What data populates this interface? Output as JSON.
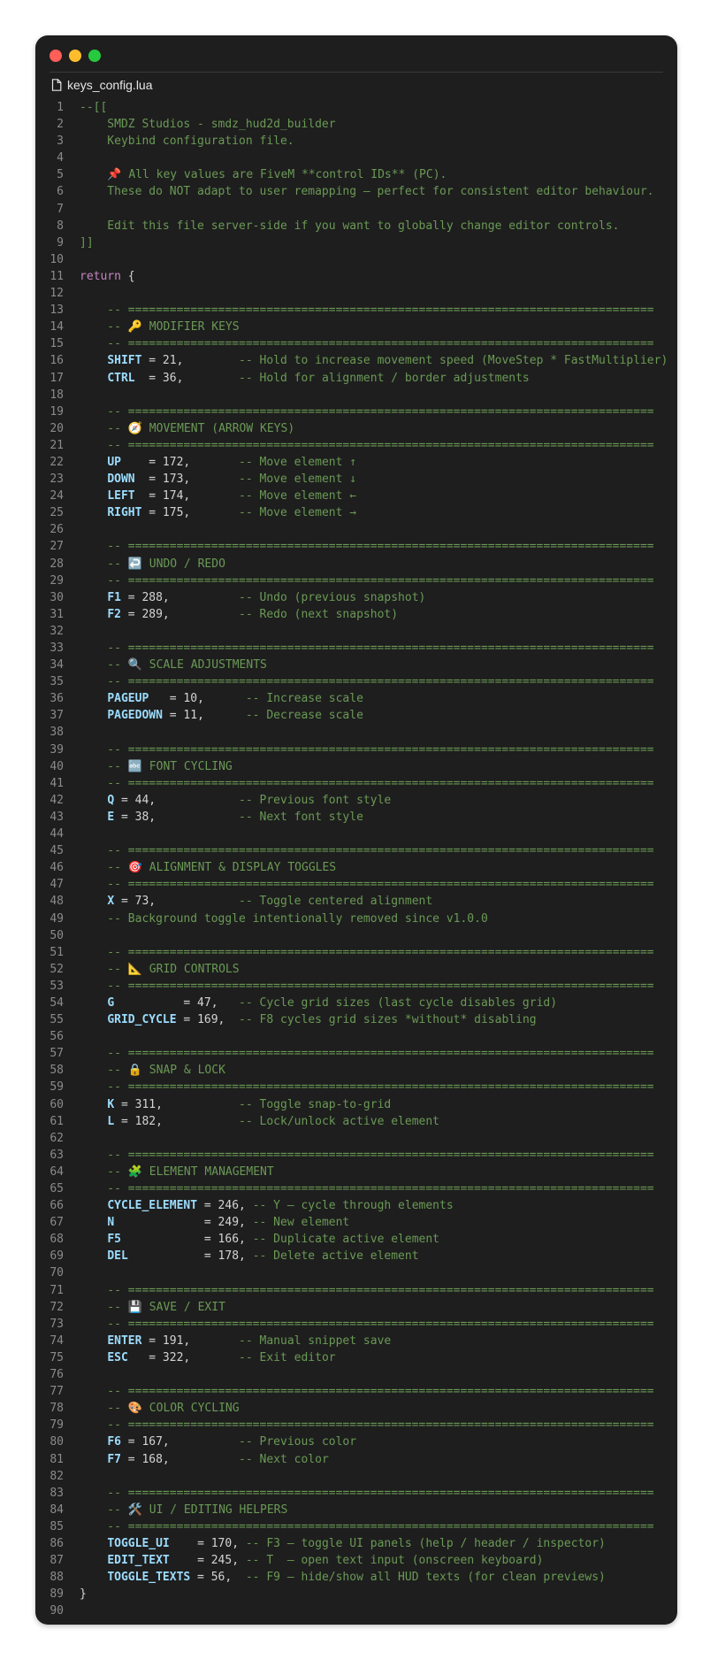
{
  "window": {
    "filename": "keys_config.lua",
    "icons": {
      "file": "file-icon"
    },
    "colors": {
      "background": "#1e1e1e",
      "comment": "#6a9955",
      "keyword": "#c586c0",
      "identifier": "#9cdcfe",
      "line_number": "#8b8b8b"
    }
  },
  "lines": [
    [
      [
        "c",
        "--[["
      ]
    ],
    [
      [
        "c",
        "    SMDZ Studios - smdz_hud2d_builder"
      ]
    ],
    [
      [
        "c",
        "    Keybind configuration file."
      ]
    ],
    [],
    [
      [
        "c",
        "    📌 All key values are FiveM **control IDs** (PC)."
      ]
    ],
    [
      [
        "c",
        "    These do NOT adapt to user remapping — perfect for consistent editor behaviour."
      ]
    ],
    [],
    [
      [
        "c",
        "    Edit this file server-side if you want to globally change editor controls."
      ]
    ],
    [
      [
        "c",
        "]]"
      ]
    ],
    [],
    [
      [
        "k",
        "return"
      ],
      [
        "p",
        " {"
      ]
    ],
    [],
    [
      [
        "c",
        "    -- ============================================================================"
      ]
    ],
    [
      [
        "c",
        "    -- 🔑 MODIFIER KEYS"
      ]
    ],
    [
      [
        "c",
        "    -- ============================================================================"
      ]
    ],
    [
      [
        "p",
        "    "
      ],
      [
        "id",
        "SHIFT"
      ],
      [
        "p",
        " = 21,        "
      ],
      [
        "c",
        "-- Hold to increase movement speed (MoveStep * FastMultiplier)"
      ]
    ],
    [
      [
        "p",
        "    "
      ],
      [
        "id",
        "CTRL"
      ],
      [
        "p",
        "  = 36,        "
      ],
      [
        "c",
        "-- Hold for alignment / border adjustments"
      ]
    ],
    [],
    [
      [
        "c",
        "    -- ============================================================================"
      ]
    ],
    [
      [
        "c",
        "    -- 🧭 MOVEMENT (ARROW KEYS)"
      ]
    ],
    [
      [
        "c",
        "    -- ============================================================================"
      ]
    ],
    [
      [
        "p",
        "    "
      ],
      [
        "id",
        "UP"
      ],
      [
        "p",
        "    = 172,       "
      ],
      [
        "c",
        "-- Move element ↑"
      ]
    ],
    [
      [
        "p",
        "    "
      ],
      [
        "id",
        "DOWN"
      ],
      [
        "p",
        "  = 173,       "
      ],
      [
        "c",
        "-- Move element ↓"
      ]
    ],
    [
      [
        "p",
        "    "
      ],
      [
        "id",
        "LEFT"
      ],
      [
        "p",
        "  = 174,       "
      ],
      [
        "c",
        "-- Move element ←"
      ]
    ],
    [
      [
        "p",
        "    "
      ],
      [
        "id",
        "RIGHT"
      ],
      [
        "p",
        " = 175,       "
      ],
      [
        "c",
        "-- Move element →"
      ]
    ],
    [],
    [
      [
        "c",
        "    -- ============================================================================"
      ]
    ],
    [
      [
        "c",
        "    -- ↩️ UNDO / REDO"
      ]
    ],
    [
      [
        "c",
        "    -- ============================================================================"
      ]
    ],
    [
      [
        "p",
        "    "
      ],
      [
        "id",
        "F1"
      ],
      [
        "p",
        " = 288,          "
      ],
      [
        "c",
        "-- Undo (previous snapshot)"
      ]
    ],
    [
      [
        "p",
        "    "
      ],
      [
        "id",
        "F2"
      ],
      [
        "p",
        " = 289,          "
      ],
      [
        "c",
        "-- Redo (next snapshot)"
      ]
    ],
    [],
    [
      [
        "c",
        "    -- ============================================================================"
      ]
    ],
    [
      [
        "c",
        "    -- 🔍 SCALE ADJUSTMENTS"
      ]
    ],
    [
      [
        "c",
        "    -- ============================================================================"
      ]
    ],
    [
      [
        "p",
        "    "
      ],
      [
        "id",
        "PAGEUP"
      ],
      [
        "p",
        "   = 10,      "
      ],
      [
        "c",
        "-- Increase scale"
      ]
    ],
    [
      [
        "p",
        "    "
      ],
      [
        "id",
        "PAGEDOWN"
      ],
      [
        "p",
        " = 11,      "
      ],
      [
        "c",
        "-- Decrease scale"
      ]
    ],
    [],
    [
      [
        "c",
        "    -- ============================================================================"
      ]
    ],
    [
      [
        "c",
        "    -- 🔤 FONT CYCLING"
      ]
    ],
    [
      [
        "c",
        "    -- ============================================================================"
      ]
    ],
    [
      [
        "p",
        "    "
      ],
      [
        "id",
        "Q"
      ],
      [
        "p",
        " = 44,            "
      ],
      [
        "c",
        "-- Previous font style"
      ]
    ],
    [
      [
        "p",
        "    "
      ],
      [
        "id",
        "E"
      ],
      [
        "p",
        " = 38,            "
      ],
      [
        "c",
        "-- Next font style"
      ]
    ],
    [],
    [
      [
        "c",
        "    -- ============================================================================"
      ]
    ],
    [
      [
        "c",
        "    -- 🎯 ALIGNMENT & DISPLAY TOGGLES"
      ]
    ],
    [
      [
        "c",
        "    -- ============================================================================"
      ]
    ],
    [
      [
        "p",
        "    "
      ],
      [
        "id",
        "X"
      ],
      [
        "p",
        " = 73,            "
      ],
      [
        "c",
        "-- Toggle centered alignment"
      ]
    ],
    [
      [
        "c",
        "    -- Background toggle intentionally removed since v1.0.0"
      ]
    ],
    [],
    [
      [
        "c",
        "    -- ============================================================================"
      ]
    ],
    [
      [
        "c",
        "    -- 📐 GRID CONTROLS"
      ]
    ],
    [
      [
        "c",
        "    -- ============================================================================"
      ]
    ],
    [
      [
        "p",
        "    "
      ],
      [
        "id",
        "G"
      ],
      [
        "p",
        "          = 47,   "
      ],
      [
        "c",
        "-- Cycle grid sizes (last cycle disables grid)"
      ]
    ],
    [
      [
        "p",
        "    "
      ],
      [
        "id",
        "GRID_CYCLE"
      ],
      [
        "p",
        " = 169,  "
      ],
      [
        "c",
        "-- F8 cycles grid sizes *without* disabling"
      ]
    ],
    [],
    [
      [
        "c",
        "    -- ============================================================================"
      ]
    ],
    [
      [
        "c",
        "    -- 🔒 SNAP & LOCK"
      ]
    ],
    [
      [
        "c",
        "    -- ============================================================================"
      ]
    ],
    [
      [
        "p",
        "    "
      ],
      [
        "id",
        "K"
      ],
      [
        "p",
        " = 311,           "
      ],
      [
        "c",
        "-- Toggle snap-to-grid"
      ]
    ],
    [
      [
        "p",
        "    "
      ],
      [
        "id",
        "L"
      ],
      [
        "p",
        " = 182,           "
      ],
      [
        "c",
        "-- Lock/unlock active element"
      ]
    ],
    [],
    [
      [
        "c",
        "    -- ============================================================================"
      ]
    ],
    [
      [
        "c",
        "    -- 🧩 ELEMENT MANAGEMENT"
      ]
    ],
    [
      [
        "c",
        "    -- ============================================================================"
      ]
    ],
    [
      [
        "p",
        "    "
      ],
      [
        "id",
        "CYCLE_ELEMENT"
      ],
      [
        "p",
        " = 246, "
      ],
      [
        "c",
        "-- Y — cycle through elements"
      ]
    ],
    [
      [
        "p",
        "    "
      ],
      [
        "id",
        "N"
      ],
      [
        "p",
        "             = 249, "
      ],
      [
        "c",
        "-- New element"
      ]
    ],
    [
      [
        "p",
        "    "
      ],
      [
        "id",
        "F5"
      ],
      [
        "p",
        "            = 166, "
      ],
      [
        "c",
        "-- Duplicate active element"
      ]
    ],
    [
      [
        "p",
        "    "
      ],
      [
        "id",
        "DEL"
      ],
      [
        "p",
        "           = 178, "
      ],
      [
        "c",
        "-- Delete active element"
      ]
    ],
    [],
    [
      [
        "c",
        "    -- ============================================================================"
      ]
    ],
    [
      [
        "c",
        "    -- 💾 SAVE / EXIT"
      ]
    ],
    [
      [
        "c",
        "    -- ============================================================================"
      ]
    ],
    [
      [
        "p",
        "    "
      ],
      [
        "id",
        "ENTER"
      ],
      [
        "p",
        " = 191,       "
      ],
      [
        "c",
        "-- Manual snippet save"
      ]
    ],
    [
      [
        "p",
        "    "
      ],
      [
        "id",
        "ESC"
      ],
      [
        "p",
        "   = 322,       "
      ],
      [
        "c",
        "-- Exit editor"
      ]
    ],
    [],
    [
      [
        "c",
        "    -- ============================================================================"
      ]
    ],
    [
      [
        "c",
        "    -- 🎨 COLOR CYCLING"
      ]
    ],
    [
      [
        "c",
        "    -- ============================================================================"
      ]
    ],
    [
      [
        "p",
        "    "
      ],
      [
        "id",
        "F6"
      ],
      [
        "p",
        " = 167,          "
      ],
      [
        "c",
        "-- Previous color"
      ]
    ],
    [
      [
        "p",
        "    "
      ],
      [
        "id",
        "F7"
      ],
      [
        "p",
        " = 168,          "
      ],
      [
        "c",
        "-- Next color"
      ]
    ],
    [],
    [
      [
        "c",
        "    -- ============================================================================"
      ]
    ],
    [
      [
        "c",
        "    -- 🛠️ UI / EDITING HELPERS"
      ]
    ],
    [
      [
        "c",
        "    -- ============================================================================"
      ]
    ],
    [
      [
        "p",
        "    "
      ],
      [
        "id",
        "TOGGLE_UI"
      ],
      [
        "p",
        "    = 170, "
      ],
      [
        "c",
        "-- F3 — toggle UI panels (help / header / inspector)"
      ]
    ],
    [
      [
        "p",
        "    "
      ],
      [
        "id",
        "EDIT_TEXT"
      ],
      [
        "p",
        "    = 245, "
      ],
      [
        "c",
        "-- T  — open text input (onscreen keyboard)"
      ]
    ],
    [
      [
        "p",
        "    "
      ],
      [
        "id",
        "TOGGLE_TEXTS"
      ],
      [
        "p",
        " = 56,  "
      ],
      [
        "c",
        "-- F9 — hide/show all HUD texts (for clean previews)"
      ]
    ],
    [
      [
        "p",
        "}"
      ]
    ],
    []
  ]
}
